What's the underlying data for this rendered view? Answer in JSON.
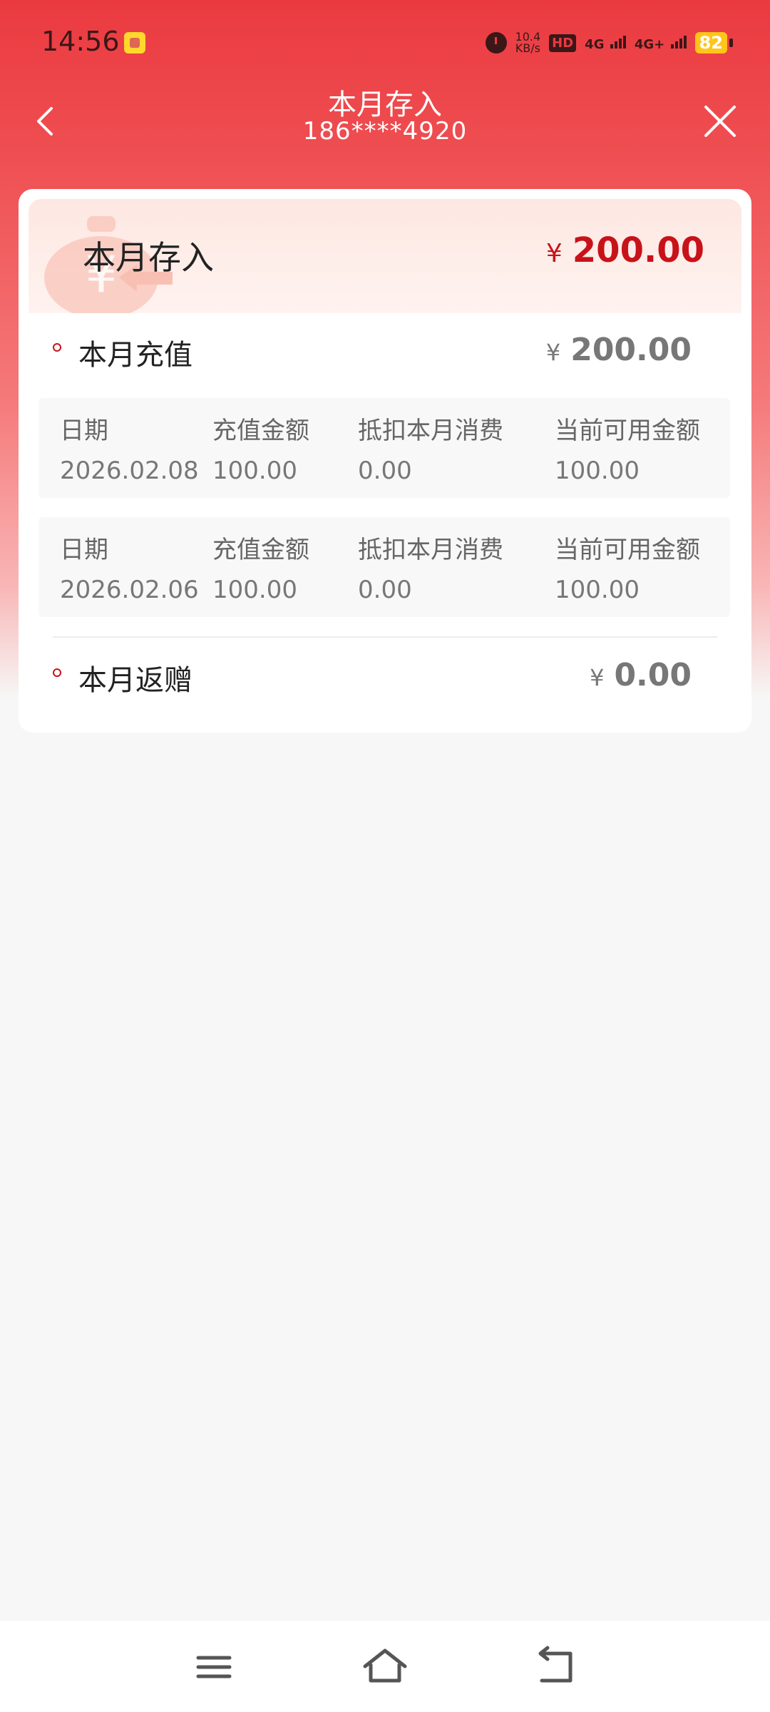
{
  "status_bar": {
    "time": "14:56",
    "net_speed_value": "10.4",
    "net_speed_unit": "KB/s",
    "hd_label": "HD",
    "sim1": "4G",
    "sim2": "4G+",
    "battery": "82"
  },
  "header": {
    "title": "本月存入",
    "subtitle": "186****4920"
  },
  "summary": {
    "label": "本月存入",
    "currency": "¥",
    "amount": "200.00"
  },
  "recharge": {
    "label": "本月充值",
    "currency": "¥",
    "amount": "200.00",
    "columns": [
      "日期",
      "充值金额",
      "抵扣本月消费",
      "当前可用金额"
    ],
    "records": [
      {
        "date": "2026.02.08",
        "amount": "100.00",
        "deduct": "0.00",
        "available": "100.00"
      },
      {
        "date": "2026.02.06",
        "amount": "100.00",
        "deduct": "0.00",
        "available": "100.00"
      }
    ]
  },
  "bonus": {
    "label": "本月返赠",
    "currency": "¥",
    "amount": "0.00"
  },
  "colors": {
    "brand_red": "#ea3a40",
    "amount_red": "#c8121a"
  },
  "icons": {
    "back": "chevron-left-icon",
    "close": "close-icon",
    "menu": "menu-icon",
    "home": "home-icon",
    "return": "return-icon"
  }
}
